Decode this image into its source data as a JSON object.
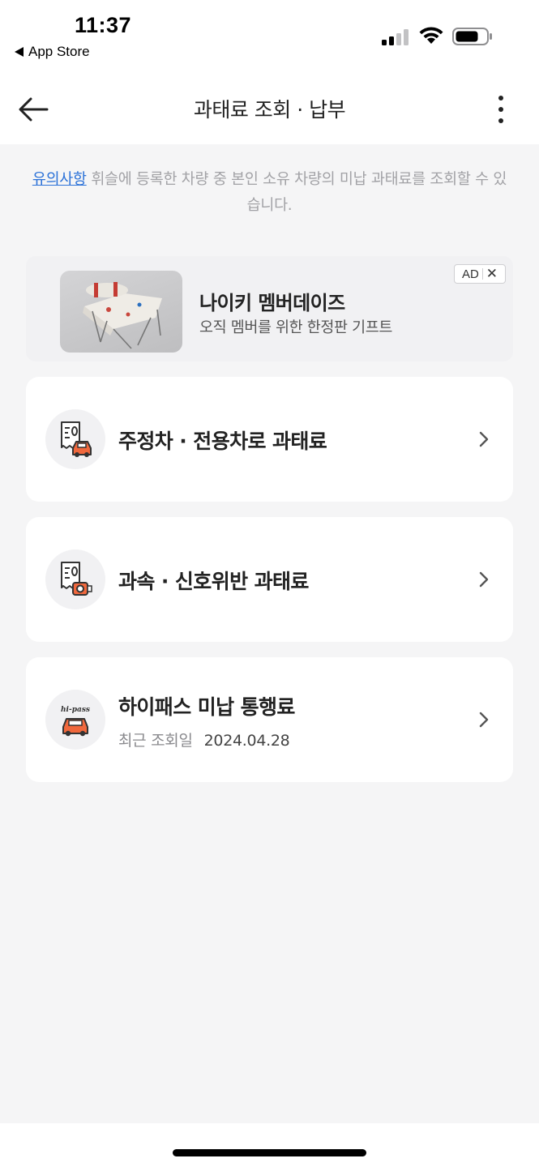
{
  "status_bar": {
    "time": "11:37",
    "back_app": "App Store"
  },
  "header": {
    "title": "과태료 조회 · 납부",
    "back_icon": "arrow-left-icon",
    "more_icon": "more-vertical-icon"
  },
  "notice": {
    "link_label": "유의사항",
    "text": " 휘슬에 등록한 차량 중 본인 소유 차량의 미납 과태료를 조회할 수 있습니다."
  },
  "ad": {
    "title": "나이키 멤버데이즈",
    "subtitle": "오직 멤버를 위한 한정판 기프트",
    "badge": "AD",
    "close": "✕"
  },
  "menu": [
    {
      "title": "주정차 · 전용차로 과태료",
      "icon": "parking-fine-icon"
    },
    {
      "title": "과속 · 신호위반 과태료",
      "icon": "speed-camera-fine-icon"
    },
    {
      "title": "하이패스 미납 통행료",
      "icon": "hipass-car-icon",
      "sub_label": "최근 조회일",
      "sub_date": "2024.04.28",
      "icon_text": "hi-pass"
    }
  ],
  "colors": {
    "accent_link": "#2c72d8",
    "icon_orange": "#f0683d",
    "background": "#f5f5f6"
  }
}
